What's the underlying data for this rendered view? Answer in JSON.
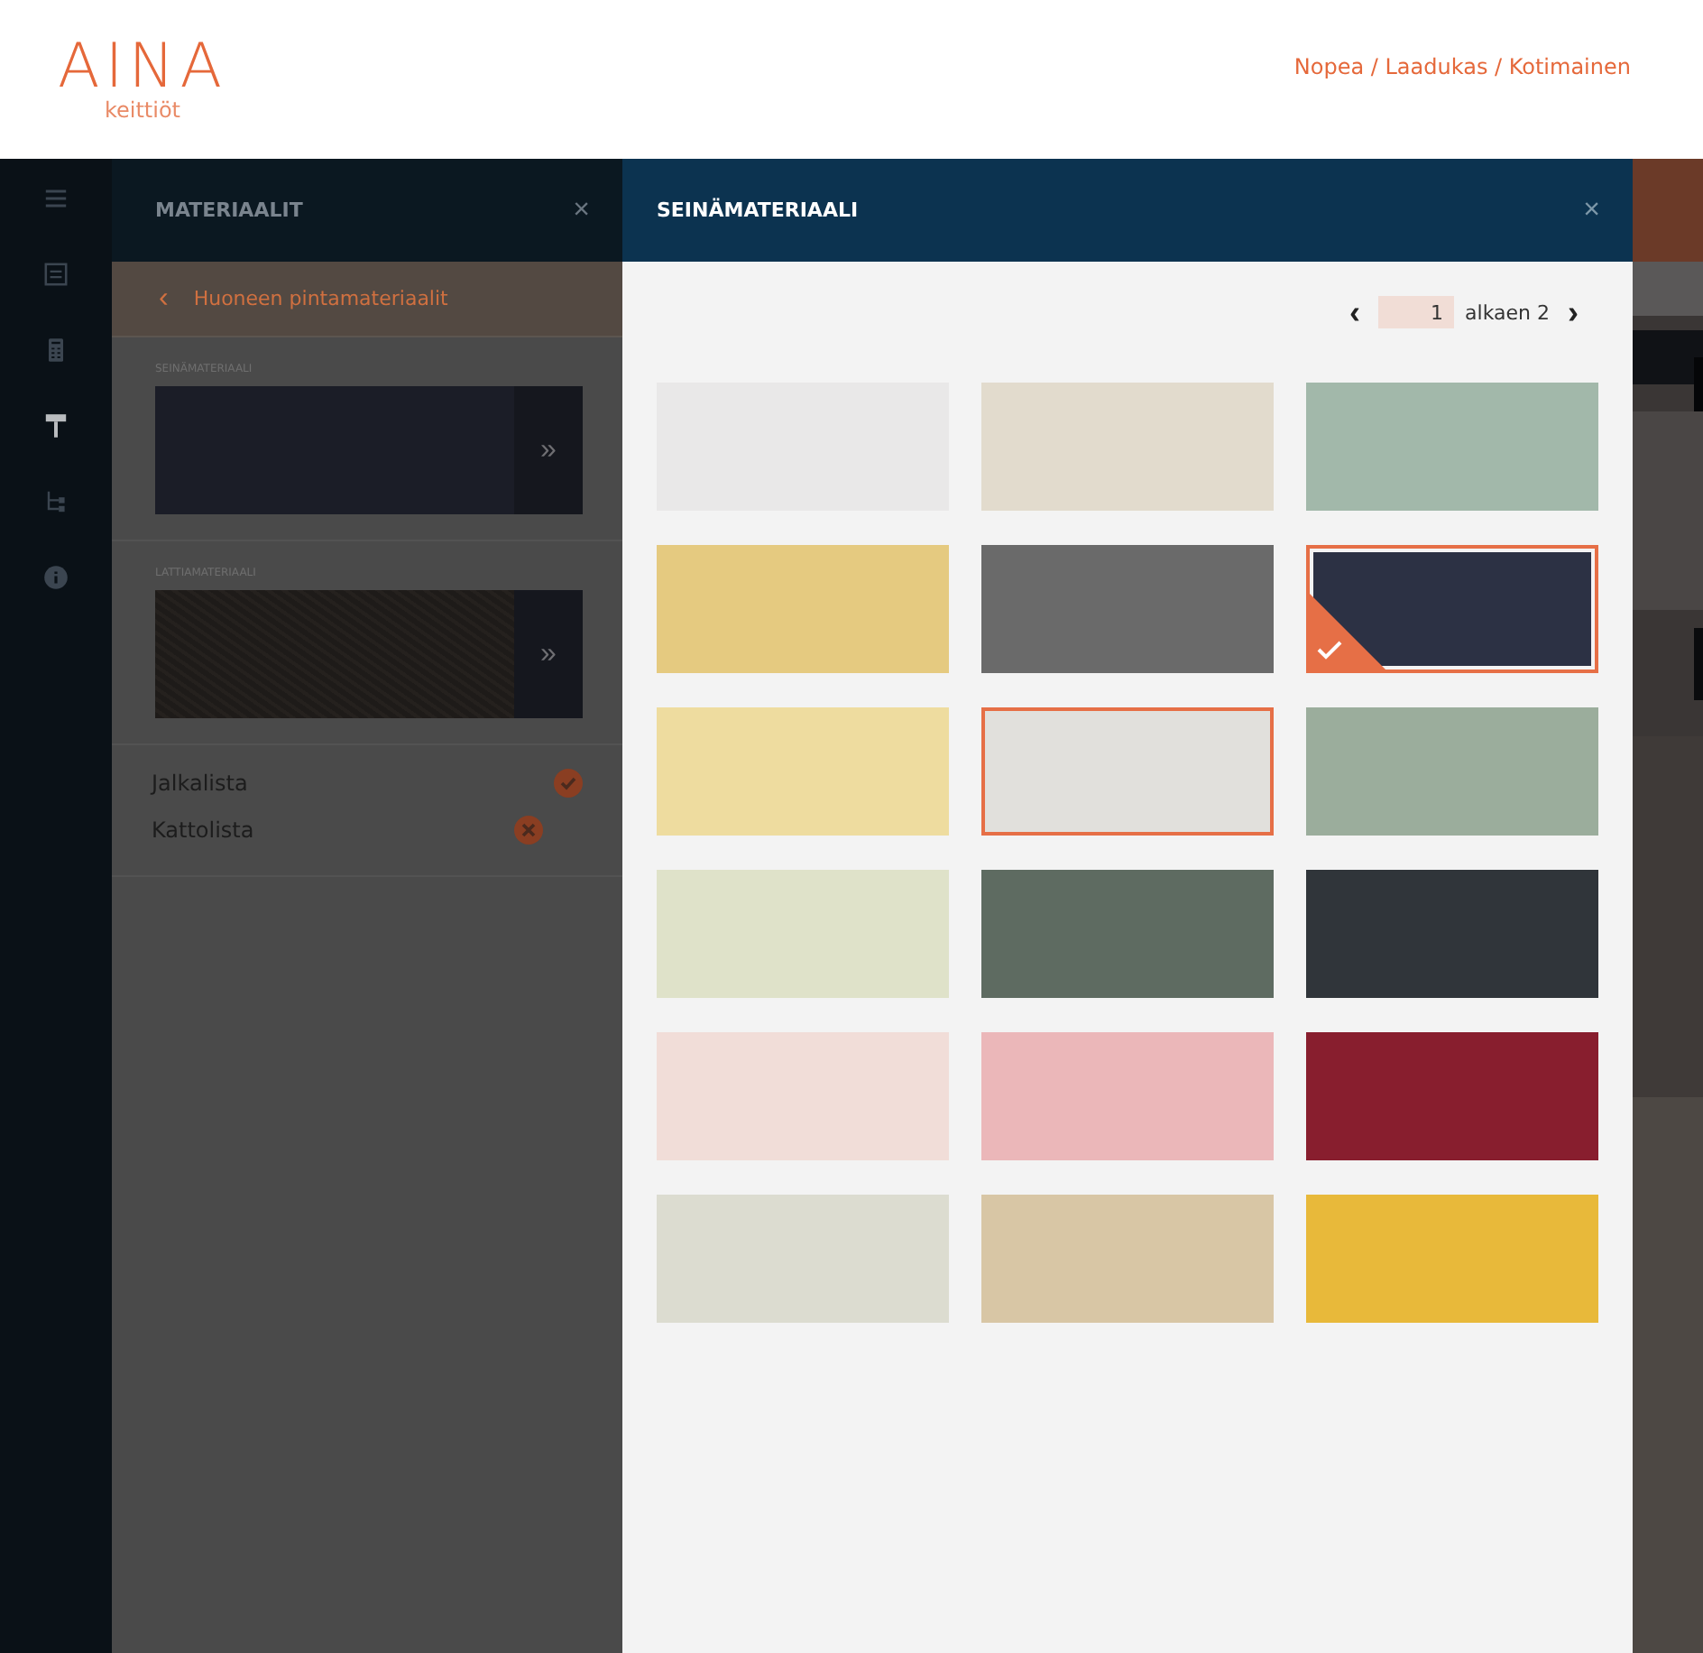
{
  "header": {
    "logo": "AINA",
    "logo_sub": "keittiöt",
    "tagline": "Nopea / Laadukas / Kotimainen"
  },
  "rail": {
    "items": [
      {
        "selected": false
      },
      {
        "selected": false
      },
      {
        "selected": false
      },
      {
        "selected": true
      },
      {
        "selected": false
      },
      {
        "selected": false
      }
    ]
  },
  "panel": {
    "title": "MATERIAALIT",
    "close": "×",
    "back": "‹",
    "back_label": "Huoneen pintamateriaalit",
    "materials": [
      {
        "label": "SEINÄMATERIAALI",
        "kind": "color",
        "color": "#1b1d27",
        "action": "»"
      },
      {
        "label": "LATTIAMATERIAALI",
        "kind": "texture",
        "color": "#1e1b19",
        "action": "»"
      }
    ],
    "options": [
      {
        "label": "Jalkalista",
        "checked": true
      },
      {
        "label": "Kattolista",
        "checked": false
      }
    ]
  },
  "modal": {
    "title": "SEINÄMATERIAALI",
    "close": "×",
    "pager": {
      "prev": "‹",
      "page": "1",
      "of": "alkaen 2",
      "next": "›"
    },
    "swatches": [
      {
        "color": "#e9e8e8",
        "selected": false,
        "highlighted": false
      },
      {
        "color": "#e2dbcd",
        "selected": false,
        "highlighted": false
      },
      {
        "color": "#a2b8aa",
        "selected": false,
        "highlighted": false
      },
      {
        "color": "#e5ca80",
        "selected": false,
        "highlighted": false
      },
      {
        "color": "#6a6a6a",
        "selected": false,
        "highlighted": false
      },
      {
        "color": "#2c3144",
        "selected": true,
        "highlighted": false
      },
      {
        "color": "#eedc9f",
        "selected": false,
        "highlighted": false
      },
      {
        "color": "#e1e0dc",
        "selected": false,
        "highlighted": true
      },
      {
        "color": "#9bad9c",
        "selected": false,
        "highlighted": false
      },
      {
        "color": "#dfe2c9",
        "selected": false,
        "highlighted": false
      },
      {
        "color": "#5e6b61",
        "selected": false,
        "highlighted": false
      },
      {
        "color": "#30353a",
        "selected": false,
        "highlighted": false
      },
      {
        "color": "#f1ddd8",
        "selected": false,
        "highlighted": false
      },
      {
        "color": "#ebb7b9",
        "selected": false,
        "highlighted": false
      },
      {
        "color": "#881e2e",
        "selected": false,
        "highlighted": false
      },
      {
        "color": "#dcdcd0",
        "selected": false,
        "highlighted": false
      },
      {
        "color": "#d8c6a5",
        "selected": false,
        "highlighted": false
      },
      {
        "color": "#e8b93a",
        "selected": false,
        "highlighted": false
      }
    ]
  }
}
